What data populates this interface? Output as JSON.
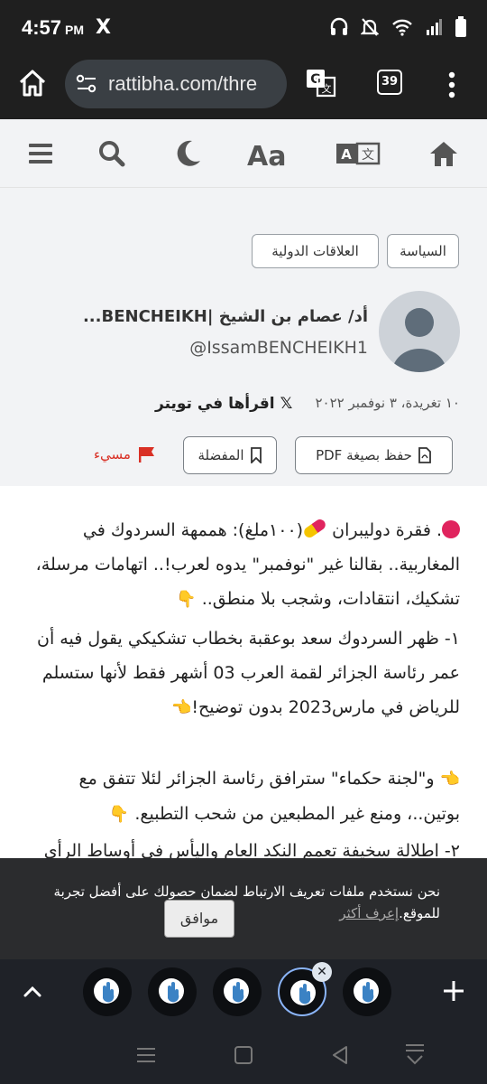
{
  "status": {
    "time": "4:57",
    "ampm": "PM",
    "notif_app": "X"
  },
  "browser": {
    "url": "rattibha.com/thre",
    "tab_count": "39"
  },
  "tags": [
    "السياسة",
    "العلاقات الدولية"
  ],
  "author": {
    "name": "أد/ عصام بن الشيخ |BENCHEIKH...",
    "handle": "@IssamBENCHEIKH1"
  },
  "meta": {
    "tweets": "١٠ تغريدة،",
    "date": "٣ نوفمبر ٢٠٢٢",
    "read_on": "اقرأها في تويتر",
    "read_icon": "𝕏"
  },
  "actions": {
    "pdf_label": "حفظ بصيغة PDF",
    "fav_label": "المفضلة",
    "report_label": "مسيء"
  },
  "article": {
    "p1_a": ". فقرة دوليبران",
    "p1_b": "(١٠٠ملغ): هممهة السردوك في المغاربية.. بقالنا غير \"نوفمبر\" يدوه لعرب!.. اتهامات مرسلة، تشكيك، انتقادات، وشجب بلا منطق..",
    "p2": "١- ظهر السردوك سعد بوعقبة بخطاب تشكيكي يقول فيه أن عمر رئاسة الجزائر لقمة العرب 03 أشهر فقط لأنها ستسلم للرياض في مارس2023 بدون توضيح!",
    "p3": "و\"لجنة حكماء\" سترافق رئاسة الجزائر لئلا تتفق مع بوتين..، ومنع غير المطبعين من شحب التطبيع.",
    "p4": "٢- اطلالة سخيفة تعمم النكد العام واليأس في أوساط الرأي"
  },
  "cookie": {
    "text": "نحن نستخدم ملفات تعريف الارتباط لضمان حصولك على أفضل تجربة",
    "text2": "للموقع.",
    "learn_more": "إعرف أكثر",
    "ok": "موافق"
  },
  "colors": {
    "dark_bar": "#1f1f1f",
    "url_bg": "#3a3f44",
    "report_red": "#d93025",
    "active_tab": "#8ab4f8"
  }
}
